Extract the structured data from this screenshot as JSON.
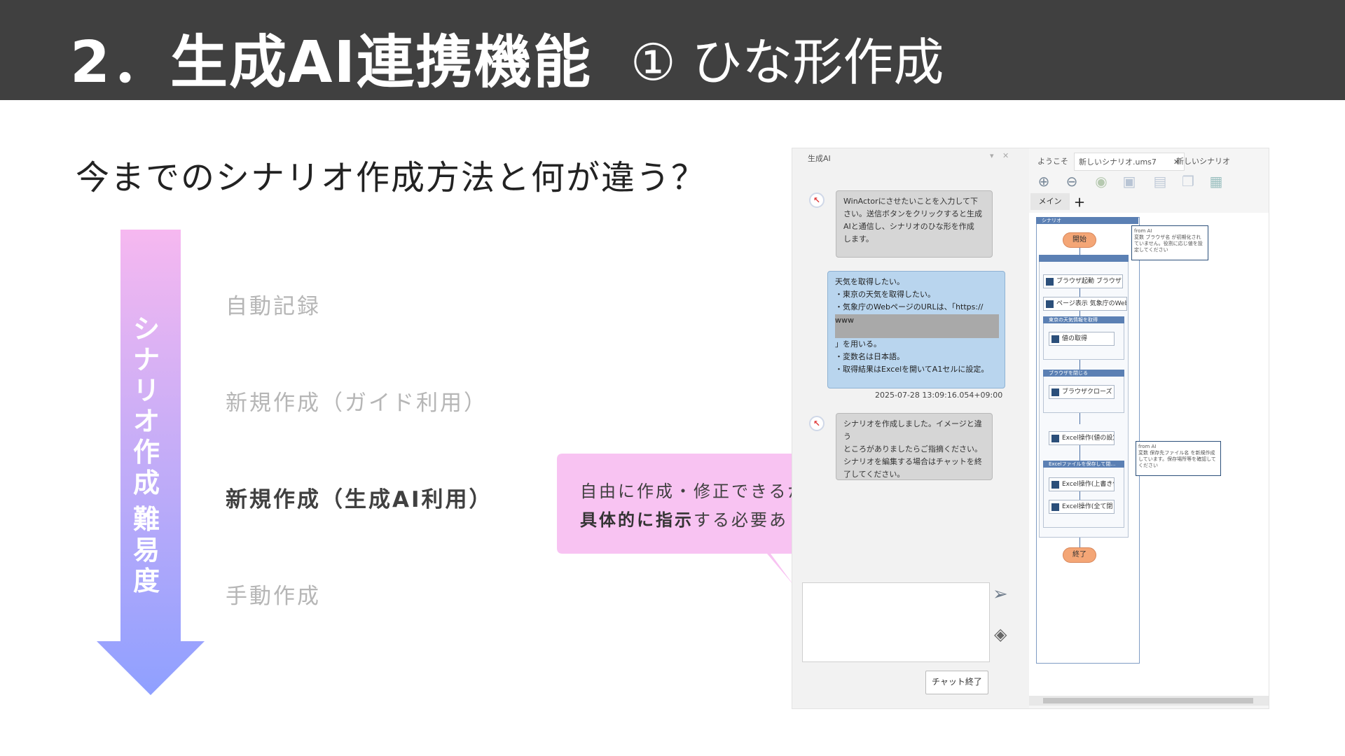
{
  "slide": {
    "title_main": "2．生成AI連携機能",
    "title_sub": "① ひな形作成",
    "question": "今までのシナリオ作成方法と何が違う？",
    "arrow_label": [
      "シ",
      "ナ",
      "リ",
      "オ",
      "作",
      "成",
      "難",
      "易",
      "度"
    ],
    "methods": [
      "自動記録",
      "新規作成（ガイド利用）",
      "新規作成（生成AI利用）",
      "手動作成"
    ],
    "callout": {
      "line1": "自由に作成・修正できるが",
      "line2_bold": "具体的に指示",
      "line2_rest": "する必要あり"
    },
    "colors": {
      "header_bg": "#404040",
      "arrow_top": "#f6b8f0",
      "arrow_bottom": "#8fa0ff",
      "callout_bg": "#f8c3f2"
    }
  },
  "app": {
    "chat_pane_title": "生成AI",
    "tabs": [
      "ようこそ",
      "新しいシナリオ.ums7",
      "新しいシナリオ"
    ],
    "subtab": "メイン",
    "add_icon": "plus-icon",
    "messages": [
      {
        "from": "ai",
        "lines": [
          "WinActorにさせたいことを入力して下",
          "さい。送信ボタンをクリックすると生成",
          "AIと通信し、シナリオのひな形を作成",
          "します。"
        ]
      },
      {
        "from": "user",
        "lines": [
          "天気を取得したい。",
          "・東京の天気を取得したい。",
          "・気象庁のWebページのURLは、「https://",
          "www",
          "」を用いる。",
          "・変数名は日本語。",
          "・取得結果はExcelを開いてA1セルに設定。"
        ],
        "timestamp": "2025-07-28 13:09:16.054+09:00"
      },
      {
        "from": "ai",
        "lines": [
          "シナリオを作成しました。イメージと違う",
          "ところがありましたらご指摘ください。",
          "シナリオを編集する場合はチャットを終",
          "了してください。"
        ]
      }
    ],
    "end_chat_button": "チャット終了",
    "flow": {
      "label": "シナリオ",
      "start": "開始",
      "end": "終了",
      "nodes": [
        "ブラウザ起動 ブラウザを起動",
        "ページ表示 気象庁のWebペー…",
        "値の取得",
        "ブラウザクローズ",
        "Excel操作(値の設定)",
        "Excel操作(上書き保存)",
        "Excel操作(全て閉じる)"
      ],
      "groups": [
        "東京の天気情報を取得",
        "ブラウザを閉じる",
        "Excelファイルを保存して閉…"
      ],
      "notes": [
        {
          "title": "from AI",
          "body": "変数 ブラウザ名 が初期化されていません。役割に応じ値を設定してください"
        },
        {
          "title": "from AI",
          "body": "変数 保存先ファイル名 を新規作成しています。保存場所等を確認してください"
        }
      ]
    }
  }
}
